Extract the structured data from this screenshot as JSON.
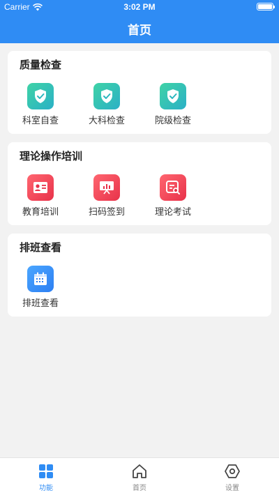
{
  "status_bar": {
    "carrier": "Carrier",
    "time": "3:02 PM"
  },
  "nav": {
    "title": "首页"
  },
  "sections": [
    {
      "title": "质量检查",
      "items": [
        {
          "label": "科室自查",
          "icon": "shield-check-icon"
        },
        {
          "label": "大科检查",
          "icon": "shield-check-icon"
        },
        {
          "label": "院级检查",
          "icon": "shield-check-icon"
        }
      ]
    },
    {
      "title": "理论操作培训",
      "items": [
        {
          "label": "教育培训",
          "icon": "id-card-icon"
        },
        {
          "label": "扫码签到",
          "icon": "presentation-chart-icon"
        },
        {
          "label": "理论考试",
          "icon": "exam-search-icon"
        }
      ]
    },
    {
      "title": "排班查看",
      "items": [
        {
          "label": "排班查看",
          "icon": "calendar-icon"
        }
      ]
    }
  ],
  "tabbar": {
    "items": [
      {
        "label": "功能",
        "active": true
      },
      {
        "label": "首页",
        "active": false
      },
      {
        "label": "设置",
        "active": false
      }
    ]
  },
  "colors": {
    "primary": "#2f8cf4",
    "green_icon": "#2bb0c6",
    "red_icon": "#e8324a",
    "blue_icon": "#2d7ff2"
  }
}
